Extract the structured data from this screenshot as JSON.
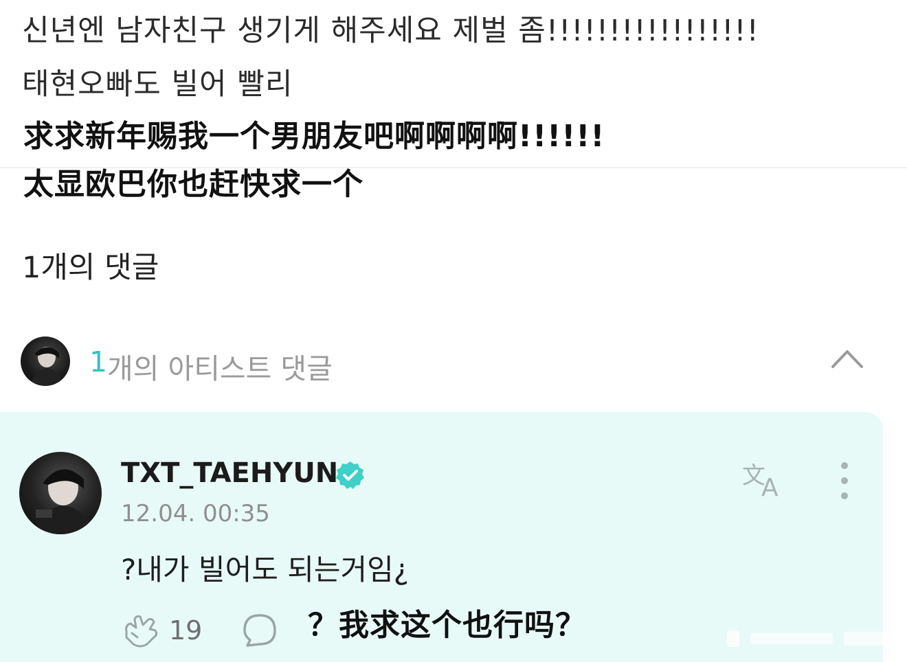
{
  "post": {
    "line1_ko": "신년엔 남자친구 생기게 해주세요 제벌 좀!!!!!!!!!!!!!!!!!",
    "line2_ko": "태현오빠도 빌어 빨리",
    "line1_zh": "求求新年赐我一个男朋友吧啊啊啊啊!!!!!!",
    "line2_zh": "太显欧巴你也赶快求一个"
  },
  "comments": {
    "count_label": "1개의 댓글"
  },
  "artist_comments": {
    "count_number": "1",
    "count_label": "개의 아티스트 댓글"
  },
  "artist_comment": {
    "username": "TXT_TAEHYUN",
    "timestamp": "12.04. 00:35",
    "text": "?내가 빌어도 되는거임¿",
    "likes": "19"
  },
  "caption_zh": "？我求这个也行吗？",
  "icons": {
    "verified": "verified-badge-icon",
    "translate": "translate-icon",
    "more": "more-vertical-icon",
    "like": "like-hand-icon",
    "reply": "reply-bubble-icon",
    "collapse": "chevron-up-icon"
  },
  "colors": {
    "accent": "#2fc6c0",
    "card_background": "#e8faf7",
    "verified": "#3fd0c8"
  }
}
